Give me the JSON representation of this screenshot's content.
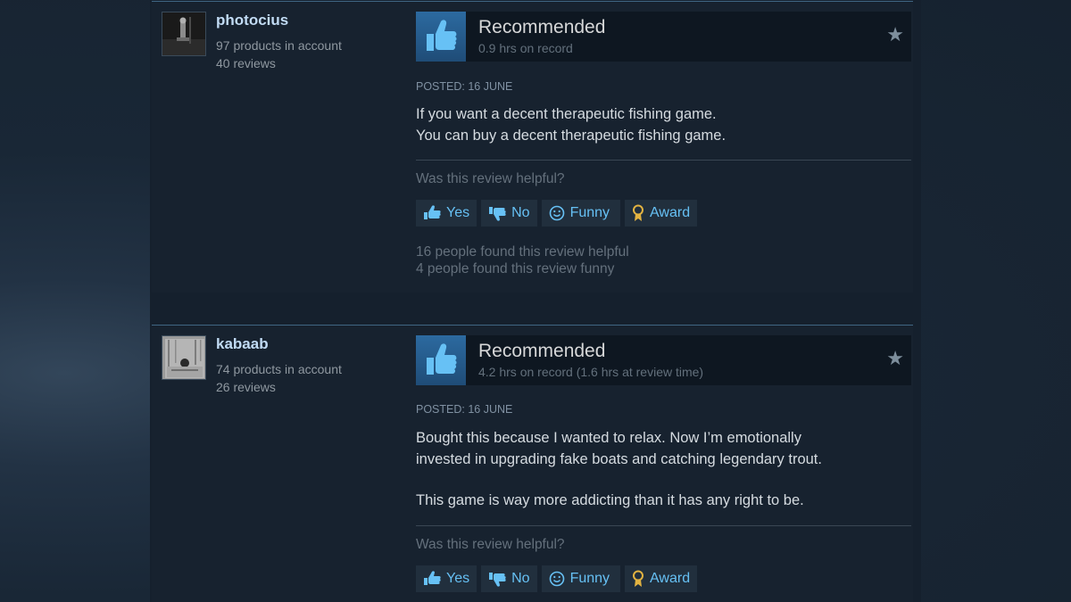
{
  "reviews": [
    {
      "author": "photocius",
      "products": "97 products in account",
      "reviews_count": "40 reviews",
      "verdict": "Recommended",
      "hours": "0.9 hrs on record",
      "posted": "POSTED: 16 JUNE",
      "body": [
        "If you want a decent therapeutic fishing game.",
        "You can buy a decent therapeutic fishing game."
      ],
      "helpful_question": "Was this review helpful?",
      "buttons": {
        "yes": "Yes",
        "no": "No",
        "funny": "Funny",
        "award": "Award"
      },
      "found_helpful": "16 people found this review helpful",
      "found_funny": "4 people found this review funny"
    },
    {
      "author": "kabaab",
      "products": "74 products in account",
      "reviews_count": "26 reviews",
      "verdict": "Recommended",
      "hours": "4.2 hrs on record (1.6 hrs at review time)",
      "posted": "POSTED: 16 JUNE",
      "body": [
        "Bought this because I wanted to relax. Now I’m emotionally",
        "invested in upgrading fake boats and catching legendary trout.",
        "This game is way more addicting than it has any right to be."
      ],
      "helpful_question": "Was this review helpful?",
      "buttons": {
        "yes": "Yes",
        "no": "No",
        "funny": "Funny",
        "award": "Award"
      }
    }
  ],
  "icons": {
    "thumb": "thumbs-up-icon",
    "star": "star-icon",
    "yes": "thumb-up-small-icon",
    "no": "thumb-down-small-icon",
    "funny": "smiley-icon",
    "award": "award-ribbon-icon"
  },
  "colors": {
    "link": "#66c0f4",
    "persona": "#c1dbf4",
    "card_bg": "#17222f",
    "vote_box": "#2c6aa0",
    "award_gold": "#e3b341"
  }
}
